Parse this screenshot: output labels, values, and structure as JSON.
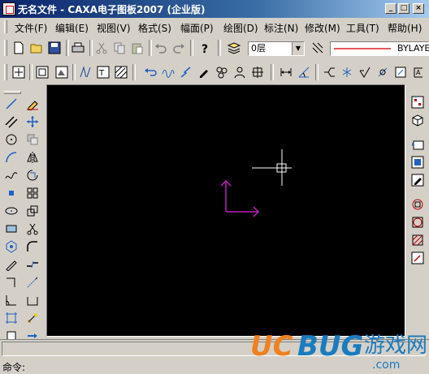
{
  "window": {
    "title": "无名文件 - CAXA电子图板2007 (企业版)",
    "minimize": "_",
    "maximize": "□",
    "close": "×"
  },
  "menu": {
    "items": [
      "文件(F)",
      "编辑(E)",
      "视图(V)",
      "格式(S)",
      "幅面(P)",
      "绘图(D)",
      "标注(N)",
      "修改(M)",
      "工具(T)",
      "帮助(H)"
    ]
  },
  "toolbar": {
    "layer": "0层",
    "linetype": "BYLAYE"
  },
  "statusbar": {
    "command_label": "命令:"
  },
  "watermark": {
    "brand": "UCBUG",
    "tagline": "游戏网",
    "url": ".com"
  },
  "colors": {
    "accent_purple": "#c020c0",
    "crosshair": "#ffffff",
    "watermark_orange": "#f08020",
    "watermark_blue": "#1a7cc0",
    "linetype_red": "#e02020"
  },
  "icons": {
    "main_toolbar": [
      "new-file-icon",
      "open-folder-icon",
      "save-icon",
      "print-icon",
      "cut-icon",
      "copy-icon",
      "paste-icon",
      "undo-icon",
      "redo-icon",
      "help-icon",
      "layer-icon",
      "linetype-icon"
    ],
    "draw_modify_toolbar": [
      "dynamic-pan-icon",
      "display-window-icon",
      "display-all-icon",
      "array-icon",
      "text-icon",
      "hatch-icon",
      "arrow-left-icon",
      "wave-icon",
      "lightning-icon",
      "pencil-icon",
      "cluster-icon",
      "person-icon",
      "block-icon",
      "dimension-icon",
      "angle-dimension-icon",
      "leader-icon",
      "gear-icon",
      "roughness-icon",
      "weld-icon",
      "datum-icon",
      "tolerance-icon"
    ],
    "left_draw": [
      "line-icon",
      "parallel-icon",
      "circle-icon",
      "arc-icon",
      "spline-icon",
      "point-icon",
      "ellipse-icon",
      "rectangle-icon",
      "polygon-icon",
      "polyline-icon",
      "center-line-icon",
      "equidistant-icon",
      "section-icon",
      "hatch-icon",
      "block-insert-icon"
    ],
    "left_modify": [
      "eraser-icon",
      "move-icon",
      "copy-move-icon",
      "mirror-icon",
      "rotate-icon",
      "array-icon",
      "scale-icon",
      "trim-icon",
      "fillet-icon",
      "break-icon",
      "extend-icon",
      "stretch-icon",
      "chamfer-icon",
      "explode-icon",
      "arrow-edit-icon"
    ],
    "right_tools": [
      "drawing-frame-icon",
      "3d-box-icon",
      "title-block-icon",
      "part-library-icon",
      "detail-icon",
      "bom-icon",
      "query-icon",
      "area-icon",
      "properties-icon",
      "zoom-icon"
    ]
  }
}
